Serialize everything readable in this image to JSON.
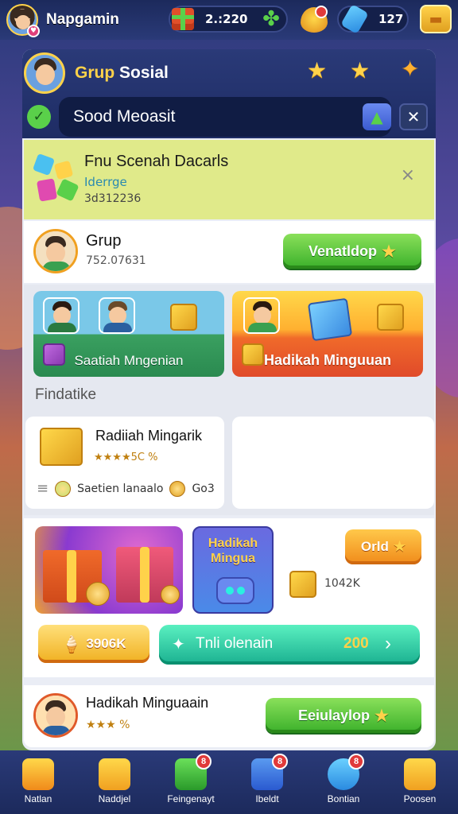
{
  "topbar": {
    "username": "Napgamin",
    "coins": "2.:220",
    "gems": "127"
  },
  "header": {
    "title_part1": "Grup",
    "title_part2": " Sosial",
    "search_text": "Sood Meoasit",
    "close_symbol": "✕"
  },
  "notification": {
    "title": "Fnu Scenah Dacarls",
    "subtitle": "Iderrge",
    "number": "3d312236",
    "close_symbol": "×"
  },
  "group_row": {
    "name": "Grup",
    "number": "752.07631",
    "button_label": "Venatldop"
  },
  "cards": {
    "left_label": "Saatiah Mngenian",
    "right_label": "Hadikah Minguuan"
  },
  "section": {
    "label": "Findatike"
  },
  "reward_card": {
    "title": "Radiiah Mingarik",
    "rating": "★★★★5C %",
    "footer_text": "Saetien lanaalo",
    "footer_extra": "Go3"
  },
  "promo": {
    "mid_text": "Hadikah Mingua",
    "orange_label": "Orld",
    "price": "1042K",
    "yellow_label": "3906K",
    "teal_label": "Tnli olenain",
    "teal_value": "200"
  },
  "last_row": {
    "title": "Hadikah Minguaain",
    "rating": "★★★ %",
    "button_label": "Eeiulaylop"
  },
  "bottom_nav": [
    {
      "label": "Natlan",
      "badge": ""
    },
    {
      "label": "Naddjel",
      "badge": ""
    },
    {
      "label": "Feingenayt",
      "badge": "8"
    },
    {
      "label": "Ibeldt",
      "badge": "8"
    },
    {
      "label": "Bontian",
      "badge": "8"
    },
    {
      "label": "Poosen",
      "badge": ""
    }
  ],
  "colors": {
    "accent_yellow": "#ffd24a",
    "green_button": "#3ab02a",
    "orange_button": "#f08a1a",
    "teal_button": "#1ab090",
    "nav_bg": "#1c2a5c"
  }
}
